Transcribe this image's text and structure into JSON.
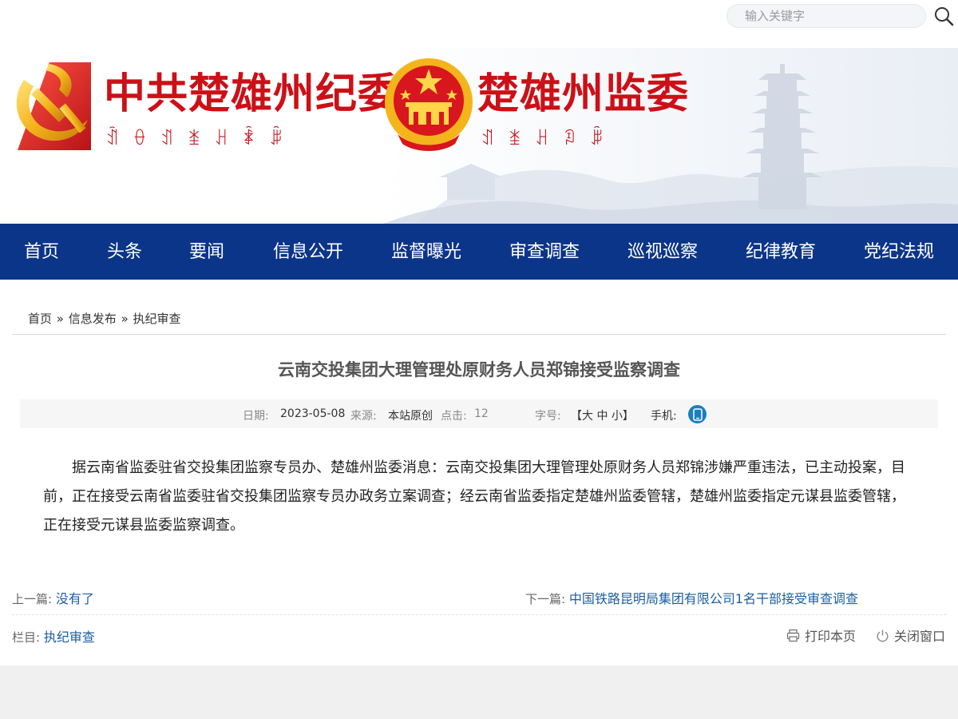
{
  "search": {
    "placeholder": "输入关键字"
  },
  "header": {
    "title_left": "中共楚雄州纪委",
    "subtitle_left": "ꀉꂷꀊꁧꃅꄑꆥ",
    "title_right": "楚雄州监委",
    "subtitle_right": "ꀊꁧꃅꀣꆥ"
  },
  "nav": {
    "items": [
      "首页",
      "头条",
      "要闻",
      "信息公开",
      "监督曝光",
      "审查调查",
      "巡视巡察",
      "纪律教育",
      "党纪法规"
    ]
  },
  "breadcrumb": {
    "items": [
      "首页",
      "信息发布",
      "执纪审查"
    ],
    "separator": "»"
  },
  "article": {
    "title": "云南交投集团大理管理处原财务人员郑锦接受监察调查",
    "meta": {
      "date_label": "日期:",
      "date": "2023-05-08",
      "source_label": "来源:",
      "source": "本站原创",
      "clicks_label": "点击:",
      "clicks": "12",
      "font_label": "字号:",
      "font_options": "【大 中 小】",
      "mobile_label": "手机:"
    },
    "body": "据云南省监委驻省交投集团监察专员办、楚雄州监委消息：云南交投集团大理管理处原财务人员郑锦涉嫌严重违法，已主动投案，目前，正在接受云南省监委驻省交投集团监察专员办政务立案调查；经云南省监委指定楚雄州监委管辖，楚雄州监委指定元谋县监委管辖，正在接受元谋县监委监察调查。"
  },
  "pager": {
    "prev_label": "上一篇:",
    "prev_text": "没有了",
    "next_label": "下一篇:",
    "next_text": "中国铁路昆明局集团有限公司1名干部接受审查调查"
  },
  "footer_bar": {
    "column_label": "栏目:",
    "column_text": "执纪审查",
    "print_label": "打印本页",
    "close_label": "关闭窗口"
  },
  "colors": {
    "nav_bg": "#0b3589",
    "title_red": "#cc1017",
    "link_blue": "#1a5fa2"
  }
}
